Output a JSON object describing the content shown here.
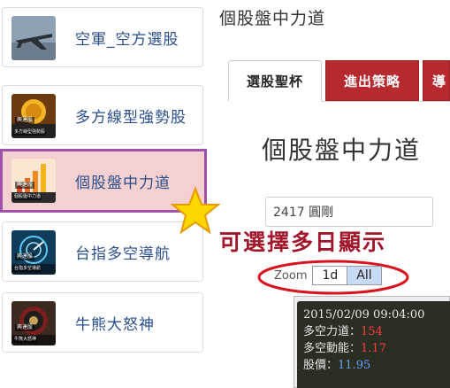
{
  "sidebar": {
    "items": [
      {
        "label": "空軍_空方選股",
        "active": false,
        "thumb_tag": "",
        "thumb_sub": ""
      },
      {
        "label": "多方線型強勢股",
        "active": false,
        "thumb_tag": "興達股",
        "thumb_sub": "多方線型強勢股"
      },
      {
        "label": "個股盤中力道",
        "active": true,
        "thumb_tag": "興達股",
        "thumb_sub": "個股盤中力道"
      },
      {
        "label": "台指多空導航",
        "active": false,
        "thumb_tag": "興達股",
        "thumb_sub": "台指多空導航"
      },
      {
        "label": "牛熊大怒神",
        "active": false,
        "thumb_tag": "興達股",
        "thumb_sub": "牛熊大怒神"
      }
    ]
  },
  "main": {
    "heading": "個股盤中力道",
    "tabs": [
      {
        "label": "選股聖杯",
        "active": true
      },
      {
        "label": "進出策略",
        "active": false
      },
      {
        "label": "導",
        "active": false
      }
    ],
    "panel_title": "個股盤中力道",
    "stock_input_value": "2417 圓剛",
    "callout": "可選擇多日顯示",
    "zoom": {
      "label": "Zoom",
      "options": [
        "1d",
        "All"
      ],
      "selected": "All"
    },
    "tooltip": {
      "datetime": "2015/02/09 09:04:00",
      "rows": [
        {
          "label": "多空力道：",
          "value": "154",
          "color": "red"
        },
        {
          "label": "多空動能：",
          "value": "1.17",
          "color": "red"
        },
        {
          "label": "股價：",
          "value": "11.95",
          "color": "blue"
        }
      ]
    }
  },
  "colors": {
    "tab_red": "#b5292f",
    "active_border": "#a052a8",
    "active_bg": "#f5d0d0",
    "link_blue": "#2a4f8c",
    "callout_red": "#a2162c"
  }
}
